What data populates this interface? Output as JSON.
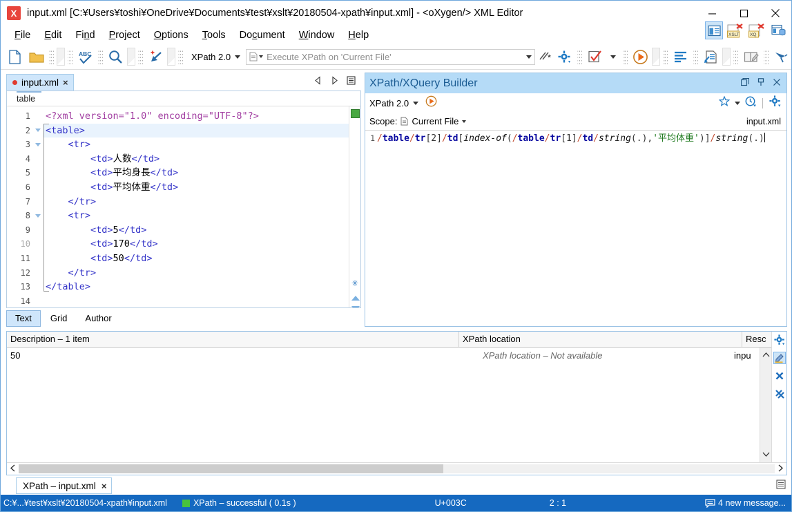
{
  "window": {
    "app_icon": "X",
    "title": "input.xml [C:¥Users¥toshi¥OneDrive¥Documents¥test¥xslt¥20180504-xpath¥input.xml] - <oXygen/> XML Editor",
    "minimize_label": "minimize-icon",
    "maximize_label": "maximize-icon",
    "close_label": "close-icon"
  },
  "menubar": {
    "items": [
      {
        "pre": "",
        "mnemonic": "F",
        "post": "ile"
      },
      {
        "pre": "",
        "mnemonic": "E",
        "post": "dit"
      },
      {
        "pre": "Fi",
        "mnemonic": "n",
        "post": "d"
      },
      {
        "pre": "",
        "mnemonic": "P",
        "post": "roject"
      },
      {
        "pre": "",
        "mnemonic": "O",
        "post": "ptions"
      },
      {
        "pre": "",
        "mnemonic": "T",
        "post": "ools"
      },
      {
        "pre": "Do",
        "mnemonic": "c",
        "post": "ument"
      },
      {
        "pre": "",
        "mnemonic": "W",
        "post": "indow"
      },
      {
        "pre": "",
        "mnemonic": "H",
        "post": "elp"
      }
    ]
  },
  "toolbar": {
    "new_file": "new-file-icon",
    "open_folder": "open-folder-icon",
    "spellcheck": "spell-check-icon",
    "find": "find-icon",
    "format_indent": "format-indent-icon",
    "xpath_version": "XPath 2.0",
    "xpath_placeholder": "Execute XPath on  'Current File'",
    "xpath_history_icon": "xpath-star-icon",
    "settings_icon": "xpath-settings-icon",
    "validate_icon": "validate-icon",
    "transform_icon": "transform-icon",
    "align_icon": "align-icon",
    "apply_icon": "apply-transform-icon",
    "book_icon": "book-edit-icon",
    "brush_icon": "brush-icon",
    "perspective_editor": "editor-perspective-icon",
    "perspective_xslt": "XSLT",
    "perspective_xq": "XQ",
    "perspective_db": "database-perspective-icon"
  },
  "editor": {
    "tab": {
      "name": "input.xml",
      "modified": true,
      "close": "×"
    },
    "nav": {
      "back": "nav-back-icon",
      "forward": "nav-forward-icon",
      "list": "tab-list-icon"
    },
    "breadcrumb": "table",
    "validation_status": "valid-green",
    "lines": [
      {
        "n": "1",
        "fold": false,
        "indent": 0,
        "text": "<?xml version=\"1.0\" encoding=\"UTF-8\"?>",
        "type": "pi",
        "highlight": false
      },
      {
        "n": "2",
        "fold": true,
        "indent": 0,
        "text": "<table>",
        "type": "tag",
        "highlight": true
      },
      {
        "n": "3",
        "fold": true,
        "indent": 1,
        "text": "<tr>",
        "type": "tag",
        "highlight": false
      },
      {
        "n": "4",
        "fold": false,
        "indent": 2,
        "text": "<td>人数</td>",
        "type": "mixed",
        "highlight": false
      },
      {
        "n": "5",
        "fold": false,
        "indent": 2,
        "text": "<td>平均身長</td>",
        "type": "mixed",
        "highlight": false
      },
      {
        "n": "6",
        "fold": false,
        "indent": 2,
        "text": "<td>平均体重</td>",
        "type": "mixed",
        "highlight": false
      },
      {
        "n": "7",
        "fold": false,
        "indent": 1,
        "text": "</tr>",
        "type": "tag",
        "highlight": false
      },
      {
        "n": "8",
        "fold": true,
        "indent": 1,
        "text": "<tr>",
        "type": "tag",
        "highlight": false
      },
      {
        "n": "9",
        "fold": false,
        "indent": 2,
        "text": "<td>5</td>",
        "type": "mixed",
        "highlight": false
      },
      {
        "n": "10",
        "fold": false,
        "indent": 2,
        "text": "<td>170</td>",
        "type": "mixed",
        "highlight": false
      },
      {
        "n": "11",
        "fold": false,
        "indent": 2,
        "text": "<td>50</td>",
        "type": "mixed",
        "highlight": false
      },
      {
        "n": "12",
        "fold": false,
        "indent": 1,
        "text": "</tr>",
        "type": "tag",
        "highlight": false
      },
      {
        "n": "13",
        "fold": false,
        "indent": 0,
        "text": "</table>",
        "type": "tag",
        "highlight": false
      },
      {
        "n": "14",
        "fold": false,
        "indent": 0,
        "text": "",
        "type": "tag",
        "highlight": false
      }
    ],
    "mode_tabs": [
      {
        "label": "Text",
        "active": true
      },
      {
        "label": "Grid",
        "active": false
      },
      {
        "label": "Author",
        "active": false
      }
    ]
  },
  "xpath_panel": {
    "title": "XPath/XQuery Builder",
    "restore_icon": "restore-panel-icon",
    "pin_icon": "pin-icon",
    "close_icon": "close-panel-icon",
    "version": "XPath 2.0",
    "run_icon": "run-xpath-icon",
    "favorites_icon": "favorites-star-icon",
    "history_icon": "history-clock-icon",
    "options_icon": "panel-options-gear-icon",
    "scope_label": "Scope:",
    "scope_value": "Current File",
    "scope_icon": "document-icon",
    "current_file": "input.xml",
    "expr_line_number": "1",
    "expression": "/table/tr[2]/td[index-of(/table/tr[1]/td/string(.),'平均体重')]/string(.)",
    "expression_tokens": [
      {
        "t": "/",
        "c": "x-slash"
      },
      {
        "t": "table",
        "c": "x-elem"
      },
      {
        "t": "/",
        "c": "x-slash"
      },
      {
        "t": "tr",
        "c": "x-elem"
      },
      {
        "t": "[",
        "c": "x-brk"
      },
      {
        "t": "2",
        "c": "x-num"
      },
      {
        "t": "]",
        "c": "x-brk"
      },
      {
        "t": "/",
        "c": "x-slash"
      },
      {
        "t": "td",
        "c": "x-elem"
      },
      {
        "t": "[",
        "c": "x-brk"
      },
      {
        "t": "index-of",
        "c": "x-fn"
      },
      {
        "t": "(",
        "c": "x-brk"
      },
      {
        "t": "/",
        "c": "x-slash"
      },
      {
        "t": "table",
        "c": "x-elem"
      },
      {
        "t": "/",
        "c": "x-slash"
      },
      {
        "t": "tr",
        "c": "x-elem"
      },
      {
        "t": "[",
        "c": "x-brk"
      },
      {
        "t": "1",
        "c": "x-num"
      },
      {
        "t": "]",
        "c": "x-brk"
      },
      {
        "t": "/",
        "c": "x-slash"
      },
      {
        "t": "td",
        "c": "x-elem"
      },
      {
        "t": "/",
        "c": "x-slash"
      },
      {
        "t": "string",
        "c": "x-fn"
      },
      {
        "t": "(.)",
        "c": "x-brk"
      },
      {
        "t": ",",
        "c": "x-brk"
      },
      {
        "t": "'平均体重'",
        "c": "x-str"
      },
      {
        "t": ")",
        "c": "x-brk"
      },
      {
        "t": "]",
        "c": "x-brk"
      },
      {
        "t": "/",
        "c": "x-slash"
      },
      {
        "t": "string",
        "c": "x-fn"
      },
      {
        "t": "(.)",
        "c": "x-brk"
      }
    ]
  },
  "results": {
    "columns": [
      "Description – 1 item",
      "XPath location",
      "Resc"
    ],
    "rows": [
      {
        "description": "50",
        "location": "XPath location – Not available",
        "resource": "inpu"
      }
    ],
    "side_icons": {
      "settings": "results-settings-gear-icon",
      "highlight": "highlight-marker-icon",
      "remove": "remove-result-icon",
      "remove_all": "remove-all-results-icon"
    },
    "scroll_up": "scroll-up-icon",
    "scroll_down": "scroll-down-icon",
    "hscroll_left": "scroll-left-icon",
    "hscroll_right": "scroll-right-icon",
    "tab": {
      "label": "XPath – input.xml",
      "close": "×"
    },
    "tab_right_icon": "results-list-icon"
  },
  "statusbar": {
    "path": "C:¥...¥test¥xslt¥20180504-xpath¥input.xml",
    "xpath_status": "XPath – successful  ( 0.1s )",
    "status_color": "#49c23c",
    "encoding": "U+003C",
    "position": "2 : 1",
    "messages": "4 new message...",
    "messages_icon": "message-balloon-icon"
  }
}
